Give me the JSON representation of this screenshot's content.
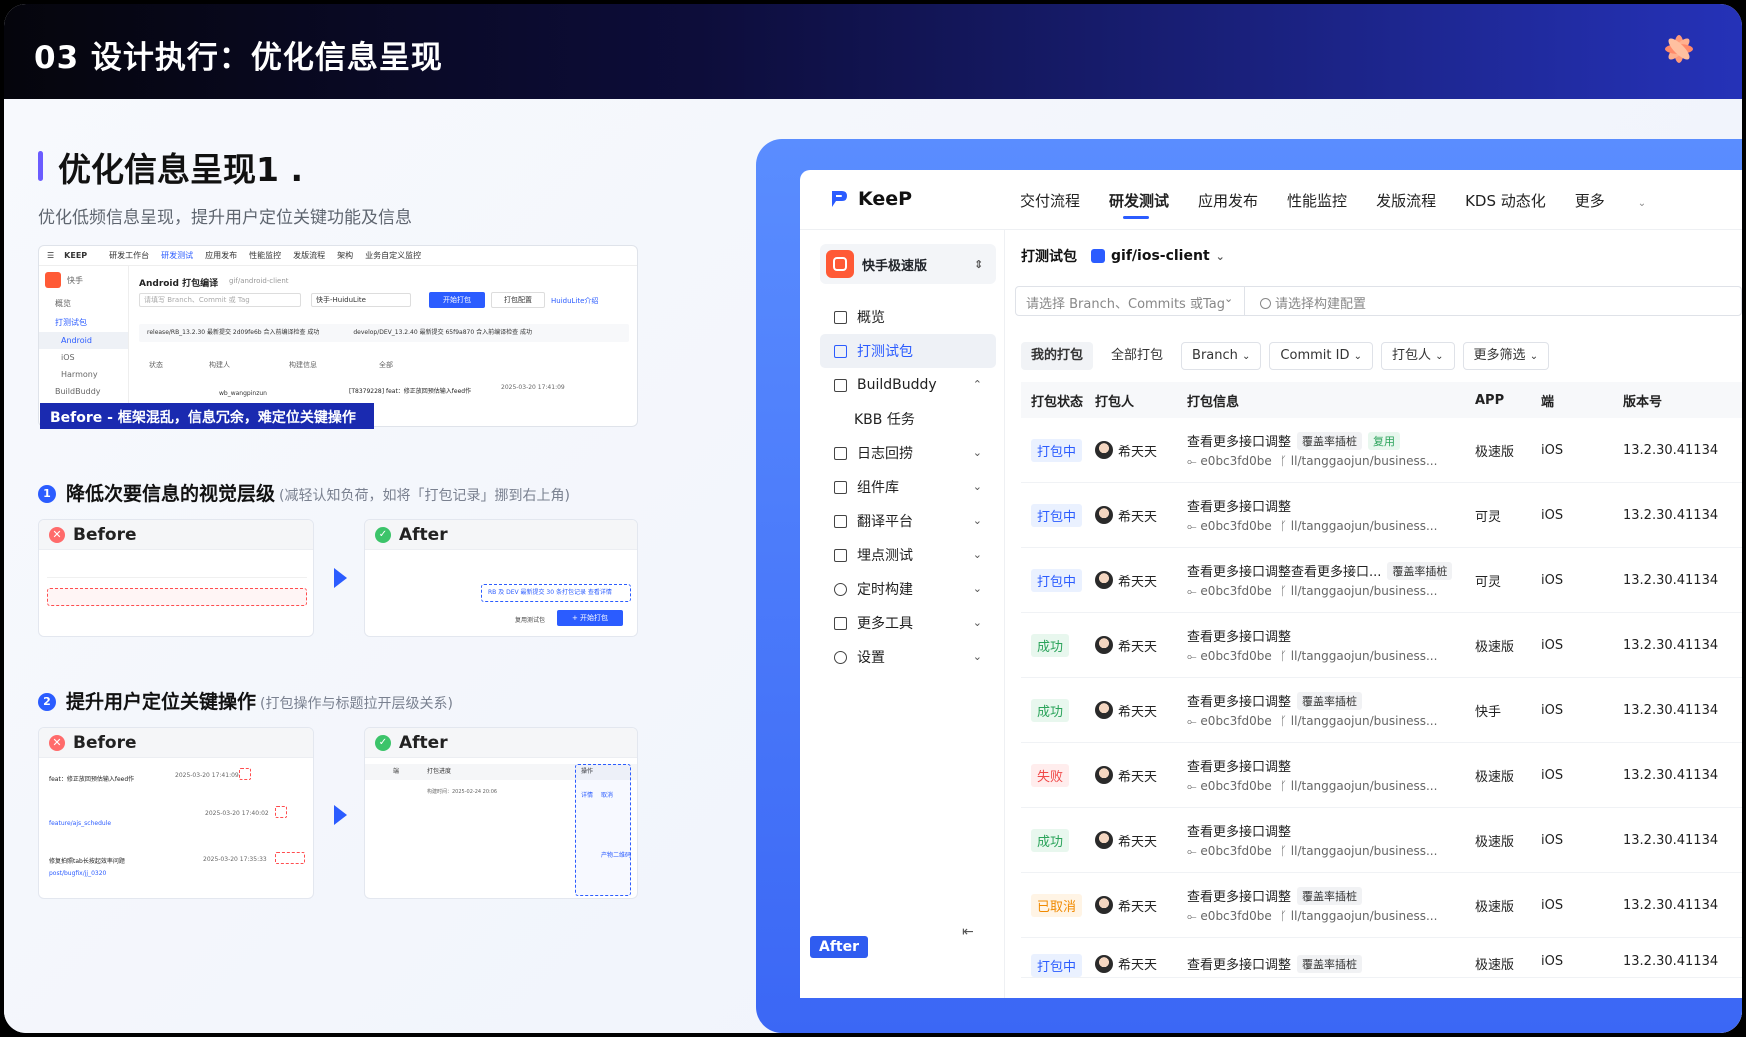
{
  "header": {
    "title": "03 设计执行：优化信息呈现"
  },
  "intro": {
    "heading": "优化信息呈现1 .",
    "subtitle": "优化低频信息呈现，提升用户定位关键功能及信息"
  },
  "before_shot": {
    "nav": [
      "KEEP",
      "研发工作台",
      "研发测试",
      "应用发布",
      "性能监控",
      "发版流程",
      "架构",
      "业务自定义监控"
    ],
    "project": "快手",
    "side": [
      "概览",
      "打测试包",
      "Android",
      "iOS",
      "Harmony",
      "BuildBuddy"
    ],
    "title": "Android 打包编译",
    "path": "gif/android-client",
    "branch_placeholder": "请填写 Branch、Commit 或 Tag",
    "config": "快手-HuiduLite",
    "start_btn": "开始打包",
    "cfg_btn": "打包配置",
    "link": "HuiduLite介绍",
    "info_a": "release/RB_13.2.30 最新提交 2d09fe6b 合入前编译检查 成功",
    "info_b": "develop/DEV_13.2.40 最新提交 65f9a870 合入前编译检查 成功",
    "cols": [
      "状态",
      "构建人",
      "构建信息",
      "全部"
    ],
    "row_user": "wb_wangpinzun",
    "row_commit": "[T8379228] feat：修正放回预估输入feed作",
    "row_time": "2025-03-20 17:41:09",
    "banner": "Before - 框架混乱，信息冗余，难定位关键操作"
  },
  "section1": {
    "num": "1",
    "title": "降低次要信息的视觉层级",
    "note": "(减轻认知负荷，如将「打包记录」挪到右上角)",
    "before_label": "Before",
    "after_label": "After",
    "after_info": "RB 及 DEV 最新提交 30 条打包记录 查看详情",
    "after_btn": "+ 开始打包",
    "after_chk": "复用测试包"
  },
  "section2": {
    "num": "2",
    "title": "提升用户定位关键操作",
    "note": "(打包操作与标题拉开层级关系)",
    "before_label": "Before",
    "after_label": "After",
    "before_rows": [
      "feat：修正放回预估输入feed作",
      "feature/ajs_schedule",
      "修复拍照tab长按起效率问题",
      "post/bugfix/jj_0320"
    ],
    "before_times": [
      "2025-03-20 17:41:09",
      "2025-03-20 17:40:02",
      "2025-03-20 17:35:33"
    ],
    "after_cols": [
      "端",
      "打包进度",
      "操作"
    ],
    "after_time": "构建时间：2025-02-24 20:06",
    "after_ops": [
      "详情",
      "取消",
      "产物二维码"
    ]
  },
  "app": {
    "brand": "KeeP",
    "nav": [
      "交付流程",
      "研发测试",
      "应用发布",
      "性能监控",
      "发版流程",
      "KDS 动态化",
      "更多"
    ],
    "project": "快手极速版",
    "menu": [
      {
        "label": "概览"
      },
      {
        "label": "打测试包"
      },
      {
        "label": "BuildBuddy"
      },
      {
        "label": "KBB 任务"
      },
      {
        "label": "日志回捞"
      },
      {
        "label": "组件库"
      },
      {
        "label": "翻译平台"
      },
      {
        "label": "埋点测试"
      },
      {
        "label": "定时构建"
      },
      {
        "label": "更多工具"
      },
      {
        "label": "设置"
      }
    ],
    "after_tag": "After",
    "crumb_title": "打测试包",
    "crumb_path": "gif/ios-client",
    "filter_branch": "请选择 Branch、Commits 或Tag",
    "filter_config": "请选择构建配置",
    "tabs": [
      "我的打包",
      "全部打包",
      "Branch",
      "Commit ID",
      "打包人",
      "更多筛选"
    ],
    "columns": [
      "打包状态",
      "打包人",
      "打包信息",
      "APP",
      "端",
      "版本号"
    ],
    "rows": [
      {
        "status": "打包中",
        "kind": "run",
        "user": "希天天",
        "title": "查看更多接口调整",
        "tag": "覆盖率插桩",
        "tag2": "复用",
        "commit": "e0bc3fd0be",
        "branch": "ll/tanggaojun/business...",
        "app": "极速版",
        "os": "iOS",
        "ver": "13.2.30.41134"
      },
      {
        "status": "打包中",
        "kind": "run",
        "user": "希天天",
        "title": "查看更多接口调整",
        "tag": "",
        "tag2": "",
        "commit": "e0bc3fd0be",
        "branch": "ll/tanggaojun/business...",
        "app": "可灵",
        "os": "iOS",
        "ver": "13.2.30.41134"
      },
      {
        "status": "打包中",
        "kind": "run",
        "user": "希天天",
        "title": "查看更多接口调整查看更多接口...",
        "tag": "覆盖率插桩",
        "tag2": "",
        "commit": "e0bc3fd0be",
        "branch": "ll/tanggaojun/business...",
        "app": "可灵",
        "os": "iOS",
        "ver": "13.2.30.41134"
      },
      {
        "status": "成功",
        "kind": "ok",
        "user": "希天天",
        "title": "查看更多接口调整",
        "tag": "",
        "tag2": "",
        "commit": "e0bc3fd0be",
        "branch": "ll/tanggaojun/business...",
        "app": "极速版",
        "os": "iOS",
        "ver": "13.2.30.41134"
      },
      {
        "status": "成功",
        "kind": "ok",
        "user": "希天天",
        "title": "查看更多接口调整",
        "tag": "覆盖率插桩",
        "tag2": "",
        "commit": "e0bc3fd0be",
        "branch": "ll/tanggaojun/business...",
        "app": "快手",
        "os": "iOS",
        "ver": "13.2.30.41134"
      },
      {
        "status": "失败",
        "kind": "fail",
        "user": "希天天",
        "title": "查看更多接口调整",
        "tag": "",
        "tag2": "",
        "commit": "e0bc3fd0be",
        "branch": "ll/tanggaojun/business...",
        "app": "极速版",
        "os": "iOS",
        "ver": "13.2.30.41134"
      },
      {
        "status": "成功",
        "kind": "ok",
        "user": "希天天",
        "title": "查看更多接口调整",
        "tag": "",
        "tag2": "",
        "commit": "e0bc3fd0be",
        "branch": "ll/tanggaojun/business...",
        "app": "极速版",
        "os": "iOS",
        "ver": "13.2.30.41134"
      },
      {
        "status": "已取消",
        "kind": "cancel",
        "user": "希天天",
        "title": "查看更多接口调整",
        "tag": "覆盖率插桩",
        "tag2": "",
        "commit": "e0bc3fd0be",
        "branch": "ll/tanggaojun/business...",
        "app": "极速版",
        "os": "iOS",
        "ver": "13.2.30.41134"
      },
      {
        "status": "打包中",
        "kind": "run",
        "user": "希天天",
        "title": "查看更多接口调整",
        "tag": "覆盖率插桩",
        "tag2": "",
        "commit": "",
        "branch": "",
        "app": "极速版",
        "os": "iOS",
        "ver": "13.2.30.41134"
      }
    ]
  },
  "colors": {
    "accent": "#2b5cff",
    "header_end": "#2532b8",
    "panel": "#3b67f5"
  }
}
